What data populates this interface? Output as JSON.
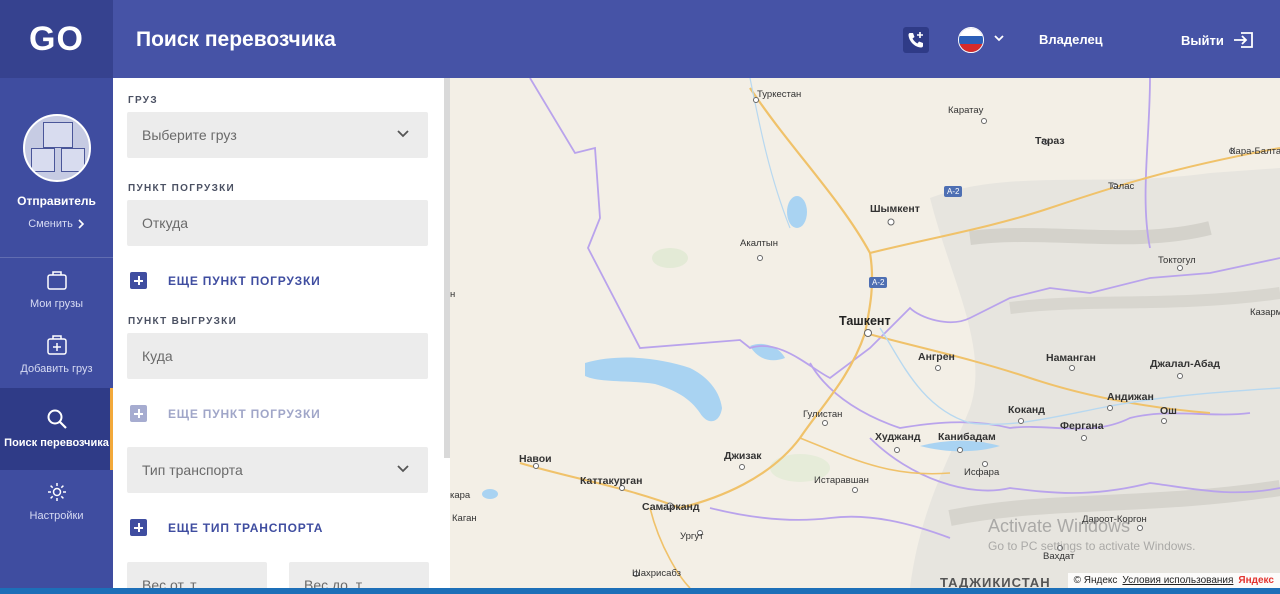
{
  "app": {
    "logo": "GO"
  },
  "sidebar": {
    "profile": {
      "role": "Отправитель",
      "change_label": "Сменить"
    },
    "items": [
      {
        "label": "Мои грузы",
        "icon": "bag-icon"
      },
      {
        "label": "Добавить груз",
        "icon": "add-package-icon"
      },
      {
        "label": "Поиск перевозчика",
        "icon": "search-icon",
        "active": true
      },
      {
        "label": "Настройки",
        "icon": "gear-icon"
      }
    ]
  },
  "header": {
    "title": "Поиск перевозчика",
    "owner_label": "Владелец",
    "logout_label": "Выйти",
    "language_flag": "ru"
  },
  "form": {
    "cargo": {
      "label": "ГРУЗ",
      "placeholder": "Выберите груз"
    },
    "loading_point": {
      "label": "ПУНКТ ПОГРУЗКИ",
      "placeholder": "Откуда"
    },
    "add_loading": "ЕЩЕ ПУНКТ ПОГРУЗКИ",
    "unloading_point": {
      "label": "ПУНКТ ВЫГРУЗКИ",
      "placeholder": "Куда"
    },
    "add_unloading": "ЕЩЕ ПУНКТ ПОГРУЗКИ",
    "transport_type": {
      "placeholder": "Тип транспорта"
    },
    "add_transport": "ЕЩЕ ТИП ТРАНСПОРТА",
    "weight_from": {
      "placeholder": "Вес от, т"
    },
    "weight_to": {
      "placeholder": "Вес до, т"
    }
  },
  "map": {
    "cities": {
      "turkestan": "Туркестан",
      "karatau": "Каратау",
      "taraz": "Тараз",
      "karabalta": "Кара-Балта",
      "talas": "Талас",
      "shymkent": "Шымкент",
      "akaltyn": "Акалтын",
      "toktogul": "Токтогул",
      "tashkent": "Ташкент",
      "angren": "Ангрен",
      "namangan": "Наманган",
      "jalalabad": "Джалал-Абад",
      "kazarman": "Казарм",
      "andijan": "Андижан",
      "osh": "Ош",
      "kokand": "Коканд",
      "gulistan": "Гулистан",
      "fergana": "Фергана",
      "khujand": "Худжанд",
      "kanibadam": "Канибадам",
      "isfara": "Исфара",
      "jizzakh": "Джизак",
      "navoi": "Навои",
      "kattakurgan": "Каттакурган",
      "istaravshan": "Истаравшан",
      "samarkand": "Самарканд",
      "karaul": "кара",
      "kagan": "Каган",
      "urgut": "Ургут",
      "shakhrisabz": "Шахрисабз",
      "daroot": "Дароот-Коргон",
      "vakhdat": "Вахдат",
      "tajikistan": "ТАДЖИКИСТАН",
      "edge_left": "н"
    },
    "roads": {
      "a2_top": "A-2",
      "a2_mid": "A-2"
    },
    "attribution": {
      "copyright": "© Яндекс",
      "terms": "Условия использования",
      "logo": "Яндекс"
    },
    "watermark": {
      "line1": "Activate Windows",
      "line2": "Go to PC settings to activate Windows."
    }
  },
  "colors": {
    "header": "#4653a6",
    "sidebar": "#3f4da0",
    "accent": "#f2a93b",
    "input_bg": "#ececec"
  }
}
